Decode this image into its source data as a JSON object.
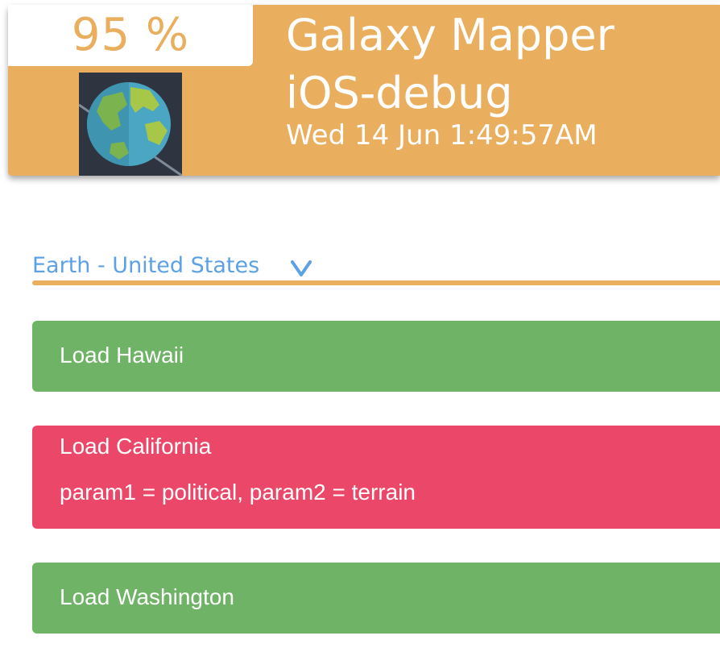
{
  "header": {
    "battery_percent": "95 %",
    "app_icon": "globe-icon",
    "app_name": "Galaxy Mapper",
    "build": "iOS-debug",
    "datetime": "Wed 14 Jun 1:49:57AM"
  },
  "selector": {
    "value": "Earth - United States",
    "icon": "chevron-down-icon"
  },
  "actions": [
    {
      "title": "Load Hawaii",
      "status": "success"
    },
    {
      "title": "Load California",
      "detail": "param1 = political, param2 = terrain",
      "status": "error"
    },
    {
      "title": "Load Washington",
      "status": "success"
    }
  ],
  "colors": {
    "accent": "#e9ae5e",
    "link": "#5ca1e6",
    "success": "#6fb366",
    "error": "#ea4769"
  }
}
